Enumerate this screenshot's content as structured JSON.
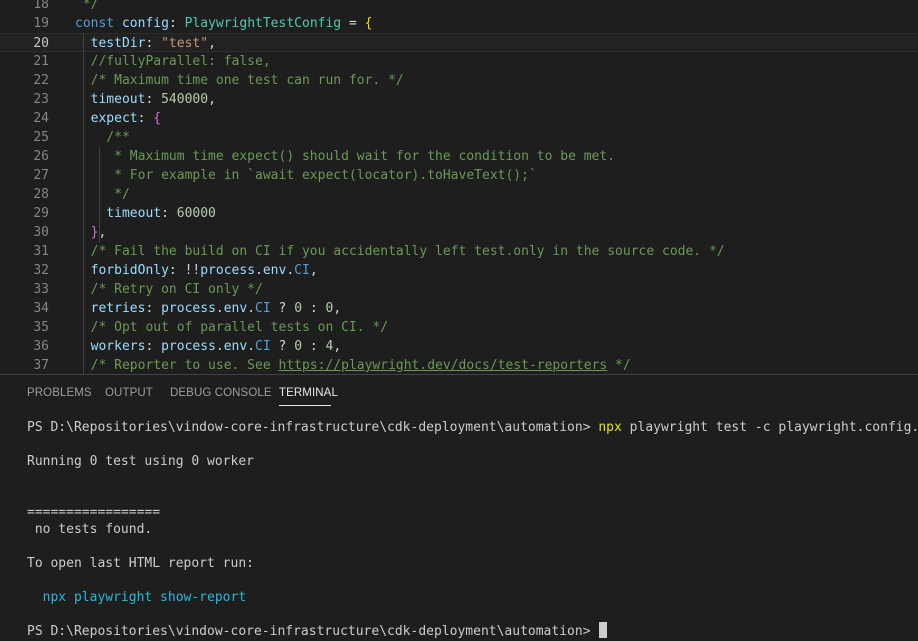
{
  "editor": {
    "current_line": "20",
    "lines": [
      {
        "num": "18",
        "tokens": [
          {
            "t": " */",
            "c": "com"
          }
        ]
      },
      {
        "num": "19",
        "tokens": [
          {
            "t": "const ",
            "c": "kw"
          },
          {
            "t": "config",
            "c": "var"
          },
          {
            "t": ": ",
            "c": "plain"
          },
          {
            "t": "PlaywrightTestConfig",
            "c": "type"
          },
          {
            "t": " = ",
            "c": "plain"
          },
          {
            "t": "{",
            "c": "brace"
          }
        ]
      },
      {
        "num": "20",
        "tokens": [
          {
            "t": "  testDir",
            "c": "var"
          },
          {
            "t": ": ",
            "c": "plain"
          },
          {
            "t": "\"test\"",
            "c": "str"
          },
          {
            "t": ",",
            "c": "plain"
          }
        ]
      },
      {
        "num": "21",
        "tokens": [
          {
            "t": "  //fullyParallel: false,",
            "c": "com"
          }
        ]
      },
      {
        "num": "22",
        "tokens": [
          {
            "t": "  /* Maximum time one test can run for. */",
            "c": "com"
          }
        ]
      },
      {
        "num": "23",
        "tokens": [
          {
            "t": "  timeout",
            "c": "var"
          },
          {
            "t": ": ",
            "c": "plain"
          },
          {
            "t": "540000",
            "c": "num"
          },
          {
            "t": ",",
            "c": "plain"
          }
        ]
      },
      {
        "num": "24",
        "tokens": [
          {
            "t": "  expect",
            "c": "var"
          },
          {
            "t": ": ",
            "c": "plain"
          },
          {
            "t": "{",
            "c": "brace2"
          }
        ]
      },
      {
        "num": "25",
        "tokens": [
          {
            "t": "    /**",
            "c": "com"
          }
        ]
      },
      {
        "num": "26",
        "tokens": [
          {
            "t": "     * Maximum time expect() should wait for the condition to be met.",
            "c": "com"
          }
        ]
      },
      {
        "num": "27",
        "tokens": [
          {
            "t": "     * For example in `await expect(locator).toHaveText();`",
            "c": "com"
          }
        ]
      },
      {
        "num": "28",
        "tokens": [
          {
            "t": "     */",
            "c": "com"
          }
        ]
      },
      {
        "num": "29",
        "tokens": [
          {
            "t": "    timeout",
            "c": "var"
          },
          {
            "t": ": ",
            "c": "plain"
          },
          {
            "t": "60000",
            "c": "num"
          }
        ]
      },
      {
        "num": "30",
        "tokens": [
          {
            "t": "  ",
            "c": "plain"
          },
          {
            "t": "}",
            "c": "brace2"
          },
          {
            "t": ",",
            "c": "plain"
          }
        ]
      },
      {
        "num": "31",
        "tokens": [
          {
            "t": "  /* Fail the build on CI if you accidentally left test.only in the source code. */",
            "c": "com"
          }
        ]
      },
      {
        "num": "32",
        "tokens": [
          {
            "t": "  forbidOnly",
            "c": "var"
          },
          {
            "t": ": !!",
            "c": "plain"
          },
          {
            "t": "process",
            "c": "var"
          },
          {
            "t": ".",
            "c": "plain"
          },
          {
            "t": "env",
            "c": "var"
          },
          {
            "t": ".",
            "c": "plain"
          },
          {
            "t": "CI",
            "c": "kw"
          },
          {
            "t": ",",
            "c": "plain"
          }
        ]
      },
      {
        "num": "33",
        "tokens": [
          {
            "t": "  /* Retry on CI only */",
            "c": "com"
          }
        ]
      },
      {
        "num": "34",
        "tokens": [
          {
            "t": "  retries",
            "c": "var"
          },
          {
            "t": ": ",
            "c": "plain"
          },
          {
            "t": "process",
            "c": "var"
          },
          {
            "t": ".",
            "c": "plain"
          },
          {
            "t": "env",
            "c": "var"
          },
          {
            "t": ".",
            "c": "plain"
          },
          {
            "t": "CI",
            "c": "kw"
          },
          {
            "t": " ? ",
            "c": "plain"
          },
          {
            "t": "0",
            "c": "num"
          },
          {
            "t": " : ",
            "c": "plain"
          },
          {
            "t": "0",
            "c": "num"
          },
          {
            "t": ",",
            "c": "plain"
          }
        ]
      },
      {
        "num": "35",
        "tokens": [
          {
            "t": "  /* Opt out of parallel tests on CI. */",
            "c": "com"
          }
        ]
      },
      {
        "num": "36",
        "tokens": [
          {
            "t": "  workers",
            "c": "var"
          },
          {
            "t": ": ",
            "c": "plain"
          },
          {
            "t": "process",
            "c": "var"
          },
          {
            "t": ".",
            "c": "plain"
          },
          {
            "t": "env",
            "c": "var"
          },
          {
            "t": ".",
            "c": "plain"
          },
          {
            "t": "CI",
            "c": "kw"
          },
          {
            "t": " ? ",
            "c": "plain"
          },
          {
            "t": "0",
            "c": "num"
          },
          {
            "t": " : ",
            "c": "plain"
          },
          {
            "t": "4",
            "c": "num"
          },
          {
            "t": ",",
            "c": "plain"
          }
        ]
      },
      {
        "num": "37",
        "tokens": [
          {
            "t": "  /* Reporter to use. See ",
            "c": "com"
          },
          {
            "t": "https://playwright.dev/docs/test-reporters",
            "c": "link"
          },
          {
            "t": " */",
            "c": "com"
          }
        ]
      }
    ]
  },
  "panel": {
    "tabs": [
      {
        "label": "PROBLEMS",
        "active": false
      },
      {
        "label": "OUTPUT",
        "active": false
      },
      {
        "label": "DEBUG CONSOLE",
        "active": false
      },
      {
        "label": "TERMINAL",
        "active": true
      }
    ]
  },
  "terminal": {
    "prompt": "PS D:\\Repositories\\vindow-core-infrastructure\\cdk-deployment\\automation> ",
    "command_exe": "npx",
    "command_args": " playwright test -c playwright.config.ts",
    "running": "Running 0 test using 0 worker",
    "separator": "=================",
    "no_tests": " no tests found.",
    "open_report": "To open last HTML report run:",
    "report_cmd": "  npx playwright show-report",
    "prompt2": "PS D:\\Repositories\\vindow-core-infrastructure\\cdk-deployment\\automation> "
  },
  "colors": {
    "background": "#1e1e1e",
    "comment": "#6a9955",
    "keyword": "#569cd6",
    "variable": "#9cdcfe",
    "type": "#4ec9b0",
    "string": "#ce9178",
    "number": "#b5cea8",
    "terminal_exe": "#e5e510",
    "terminal_link": "#29b8db"
  }
}
